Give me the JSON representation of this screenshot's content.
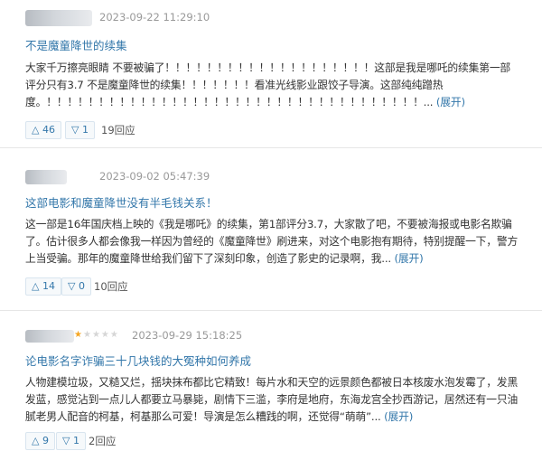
{
  "reviews": [
    {
      "date": "2023-09-22 11:29:10",
      "title": "不是魔童降世的续集",
      "body_text": "大家千万擦亮眼睛 不要被骗了！！！！！！！！！！！！！！！！！！！！这部是我是哪吒的续集第一部评分只有3.7 不是魔童降世的续集！！！！！！！看准光线影业跟饺子导演。这部纯纯蹭热度。！！！！！！！！！！！！！！！！！！！！！！！！！！！！！！！！！！！！... ",
      "expand": "(展开)",
      "upvotes": "46",
      "downvotes": "1",
      "replies": "19回应"
    },
    {
      "date": "2023-09-02 05:47:39",
      "title": "这部电影和魔童降世没有半毛钱关系！",
      "body_text": "这一部是16年国庆档上映的《我是哪吒》的续集，第1部评分3.7，大家散了吧，不要被海报或电影名欺骗了。估计很多人都会像我一样因为曾经的《魔童降世》刷进来，对这个电影抱有期待，特别提醒一下，警方上当受骗。那年的魔童降世给我们留下了深刻印象，创造了影史的记录啊，我... ",
      "expand": "(展开)",
      "upvotes": "14",
      "downvotes": "0",
      "replies": "10回应"
    },
    {
      "date": "2023-09-29 15:18:25",
      "rating_stars": 1,
      "title": "论电影名字诈骗三十几块钱的大冤种如何养成",
      "body_text": "人物建模垃圾，又糙又烂，揺块抹布都比它精致！每片水和天空的远景颜色都被日本核废水泡发霉了，发黑发蓝，感觉沾到一点儿人都要立马暴毙，剧情下三滥，李府是地府，东海龙宫全抄西游记，居然还有一只油腻老男人配音的柯基，柯基那么可爱！导演是怎么糟践的啊，还觉得“萌萌”... ",
      "expand": "(展开)",
      "upvotes": "9",
      "downvotes": "1",
      "replies": "2回应"
    }
  ],
  "icons": {
    "upvote": "triangle-up",
    "downvote": "triangle-down",
    "star": "star"
  },
  "colors": {
    "link": "#3377aa",
    "star": "#f5a623",
    "meta": "#999999"
  }
}
